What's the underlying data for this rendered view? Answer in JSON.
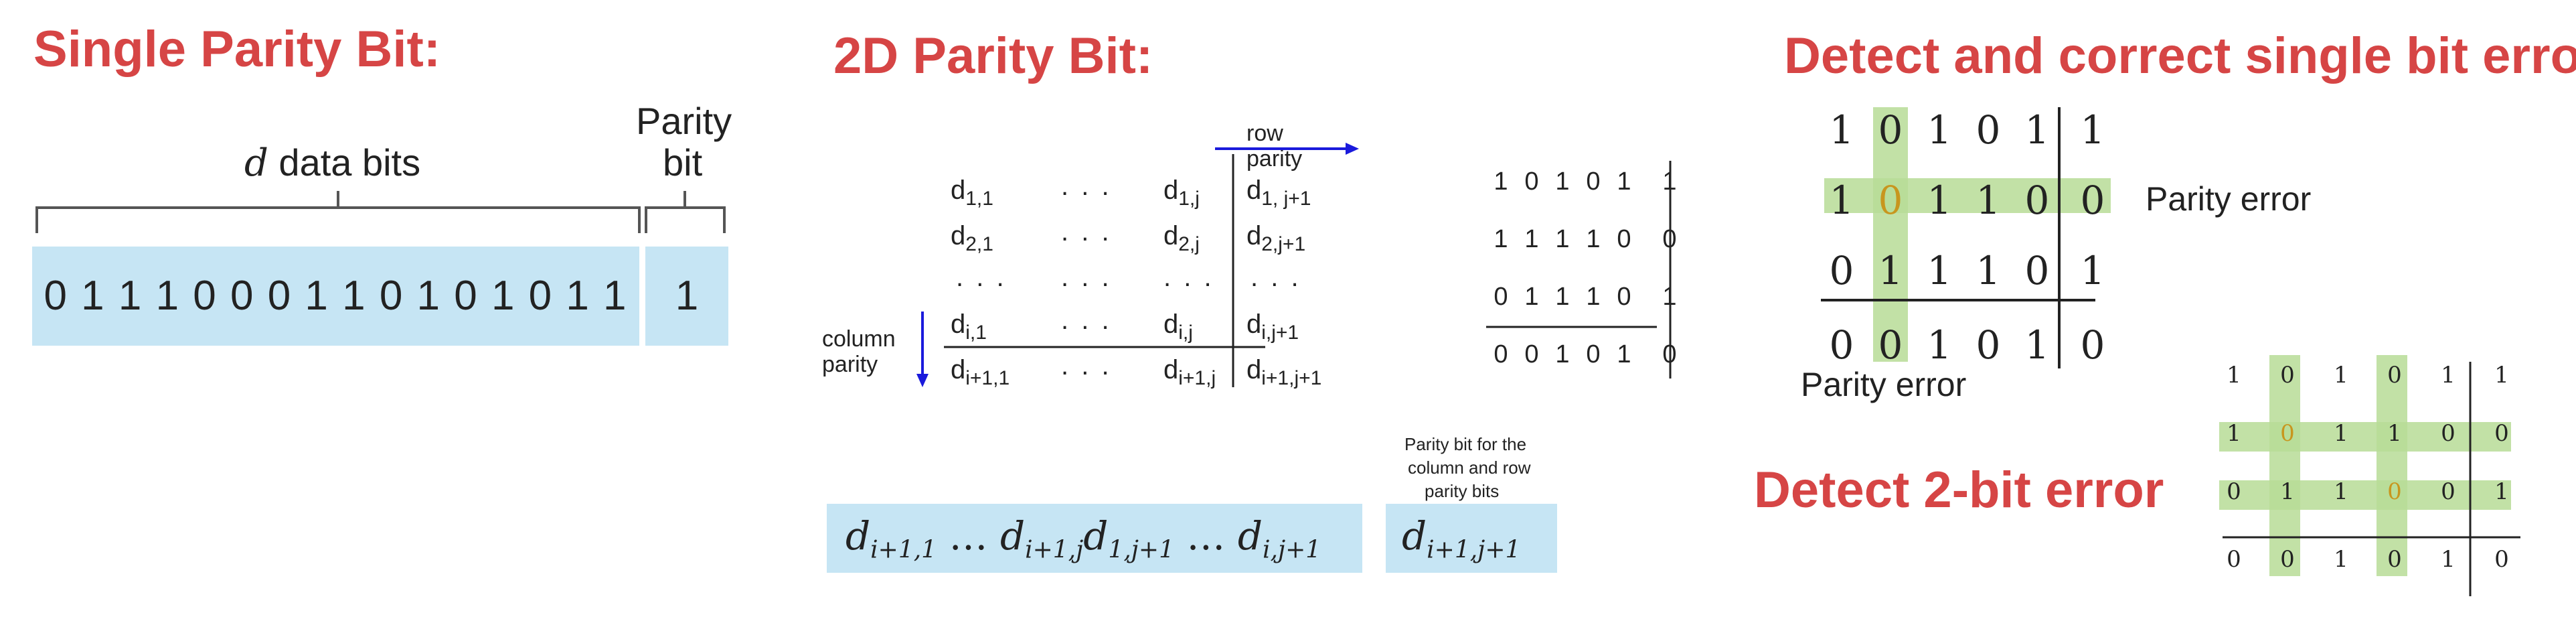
{
  "single": {
    "title": "Single Parity Bit:",
    "d_italic": "d",
    "data_label": " data bits",
    "parity_label_1": "Parity",
    "parity_label_2": "bit",
    "data_bits": "0 1 1 1 0 0 0 1 1 0 1 0 1 0 1 1",
    "parity_value": "1"
  },
  "twod": {
    "title": "2D Parity Bit:",
    "row_parity_1": "row",
    "row_parity_2": "parity",
    "column_parity_1": "column",
    "column_parity_2": "parity",
    "dots": ". . .",
    "symbolic": [
      [
        "d",
        "1,1",
        "d",
        "1,j",
        "d",
        "1, j+1"
      ],
      [
        "d",
        "2,1",
        "d",
        "2,j",
        "d",
        "2,j+1"
      ],
      [
        "d",
        "i,1",
        "d",
        "i,j",
        "d",
        "i,j+1"
      ],
      [
        "d",
        "i+1,1",
        "d",
        "i+1,j",
        "d",
        "i+1,j+1"
      ]
    ],
    "example_matrix": [
      [
        "1",
        "0",
        "1",
        "0",
        "1",
        "1"
      ],
      [
        "1",
        "1",
        "1",
        "1",
        "0",
        "0"
      ],
      [
        "0",
        "1",
        "1",
        "1",
        "0",
        "1"
      ],
      [
        "0",
        "0",
        "1",
        "0",
        "1",
        "0"
      ]
    ],
    "parity_note_1": "Parity bit for the",
    "parity_note_2": "column and row",
    "parity_note_3": "parity bits",
    "formula": {
      "d": "d",
      "sub1": "i+1,1",
      "ellipsis": " … ",
      "sub2": "i+1,j",
      "sub3": "1,j+1",
      "sub4": "i,j+1"
    },
    "corner": {
      "d": "d",
      "sub": "i+1,j+1"
    }
  },
  "single_error": {
    "title": "Detect and correct single bit error",
    "matrix": [
      [
        "1",
        "0",
        "1",
        "0",
        "1",
        "1"
      ],
      [
        "1",
        "0",
        "1",
        "1",
        "0",
        "0"
      ],
      [
        "0",
        "1",
        "1",
        "1",
        "0",
        "1"
      ],
      [
        "0",
        "0",
        "1",
        "0",
        "1",
        "0"
      ]
    ],
    "row_error_label": "Parity error",
    "col_error_label": "Parity error"
  },
  "double_error": {
    "title": "Detect 2-bit error",
    "matrix": [
      [
        "1",
        "0",
        "1",
        "0",
        "1",
        "1"
      ],
      [
        "1",
        "0",
        "1",
        "1",
        "0",
        "0"
      ],
      [
        "0",
        "1",
        "1",
        "0",
        "0",
        "1"
      ],
      [
        "0",
        "0",
        "1",
        "0",
        "1",
        "0"
      ]
    ]
  },
  "colors": {
    "title_red": "#d64545",
    "box_blue": "#c6e5f4",
    "highlight_green": "#b7dc96",
    "arrow_blue": "#1a1adc",
    "error_orange": "#c8961e"
  }
}
